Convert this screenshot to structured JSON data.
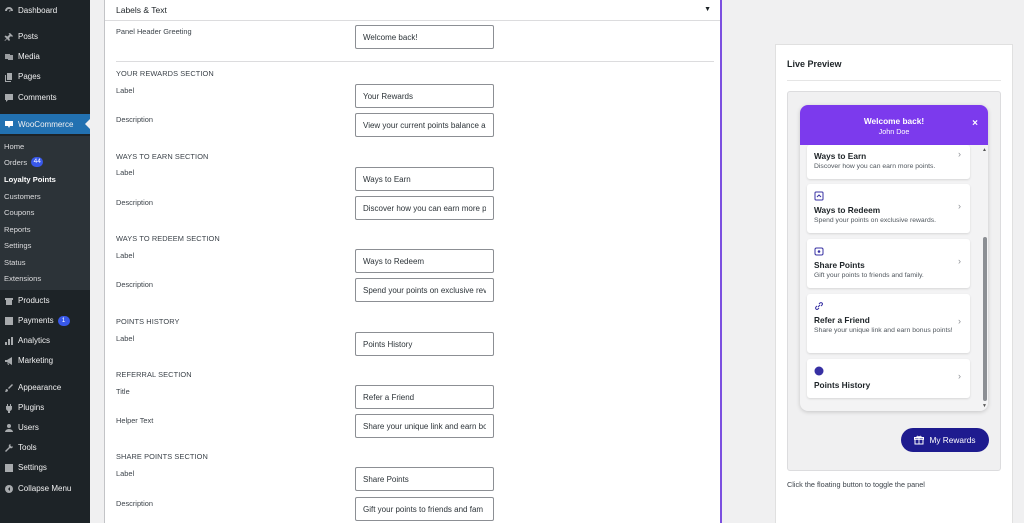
{
  "sidebar": {
    "top_items": [
      {
        "label": "Dashboard",
        "icon": "dashboard-icon"
      },
      {
        "label": "Posts",
        "icon": "pin-icon"
      },
      {
        "label": "Media",
        "icon": "media-icon"
      },
      {
        "label": "Pages",
        "icon": "pages-icon"
      },
      {
        "label": "Comments",
        "icon": "comment-icon"
      },
      {
        "label": "WooCommerce",
        "icon": "woo-icon"
      }
    ],
    "submenu": [
      {
        "label": "Home"
      },
      {
        "label": "Orders",
        "badge": "44"
      },
      {
        "label": "Loyalty Points"
      },
      {
        "label": "Customers"
      },
      {
        "label": "Coupons"
      },
      {
        "label": "Reports"
      },
      {
        "label": "Settings"
      },
      {
        "label": "Status"
      },
      {
        "label": "Extensions"
      }
    ],
    "bottom_items": [
      {
        "label": "Products",
        "icon": "products-icon"
      },
      {
        "label": "Payments",
        "icon": "payments-icon",
        "badge": "1"
      },
      {
        "label": "Analytics",
        "icon": "analytics-icon"
      },
      {
        "label": "Marketing",
        "icon": "megaphone-icon"
      },
      {
        "label": "Appearance",
        "icon": "brush-icon"
      },
      {
        "label": "Plugins",
        "icon": "plugin-icon"
      },
      {
        "label": "Users",
        "icon": "users-icon"
      },
      {
        "label": "Tools",
        "icon": "wrench-icon"
      },
      {
        "label": "Settings",
        "icon": "settings-icon"
      },
      {
        "label": "Collapse Menu",
        "icon": "collapse-icon"
      }
    ]
  },
  "settings": {
    "section_title": "Labels & Text",
    "panel_header": {
      "label": "Panel Header Greeting",
      "value": "Welcome back!"
    },
    "groups": [
      {
        "heading": "YOUR REWARDS SECTION",
        "fields": [
          {
            "label": "Label",
            "value": "Your Rewards"
          },
          {
            "label": "Description",
            "value": "View your current points balance a"
          }
        ]
      },
      {
        "heading": "WAYS TO EARN SECTION",
        "fields": [
          {
            "label": "Label",
            "value": "Ways to Earn"
          },
          {
            "label": "Description",
            "value": "Discover how you can earn more p"
          }
        ]
      },
      {
        "heading": "WAYS TO REDEEM SECTION",
        "fields": [
          {
            "label": "Label",
            "value": "Ways to Redeem"
          },
          {
            "label": "Description",
            "value": "Spend your points on exclusive rev"
          }
        ]
      },
      {
        "heading": "POINTS HISTORY",
        "fields": [
          {
            "label": "Label",
            "value": "Points History"
          }
        ]
      },
      {
        "heading": "REFERRAL SECTION",
        "fields": [
          {
            "label": "Title",
            "value": "Refer a Friend"
          },
          {
            "label": "Helper Text",
            "value": "Share your unique link and earn bo"
          }
        ]
      },
      {
        "heading": "SHARE POINTS SECTION",
        "fields": [
          {
            "label": "Label",
            "value": "Share Points"
          },
          {
            "label": "Description",
            "value": "Gift your points to friends and fam"
          }
        ]
      }
    ]
  },
  "preview": {
    "title": "Live Preview",
    "caption": "Click the floating button to toggle the panel",
    "panel": {
      "greeting": "Welcome back!",
      "user": "John Doe",
      "close_glyph": "×",
      "cards": [
        {
          "title": "Ways to Earn",
          "desc": "Discover how you can earn more points.",
          "icon": "none"
        },
        {
          "title": "Ways to Redeem",
          "desc": "Spend your points on exclusive rewards.",
          "icon": "redeem-icon"
        },
        {
          "title": "Share Points",
          "desc": "Gift your points to friends and family.",
          "icon": "share-icon"
        },
        {
          "title": "Refer a Friend",
          "desc": "Share your unique link and earn bonus points!",
          "icon": "link-icon"
        },
        {
          "title": "Points History",
          "desc": "",
          "icon": "history-dot-icon"
        }
      ],
      "chevron": "›"
    },
    "floating_button": "My Rewards",
    "colors": {
      "accent": "#7c3aed",
      "button": "#1e1b8f",
      "wp_blue": "#2271b1"
    }
  }
}
